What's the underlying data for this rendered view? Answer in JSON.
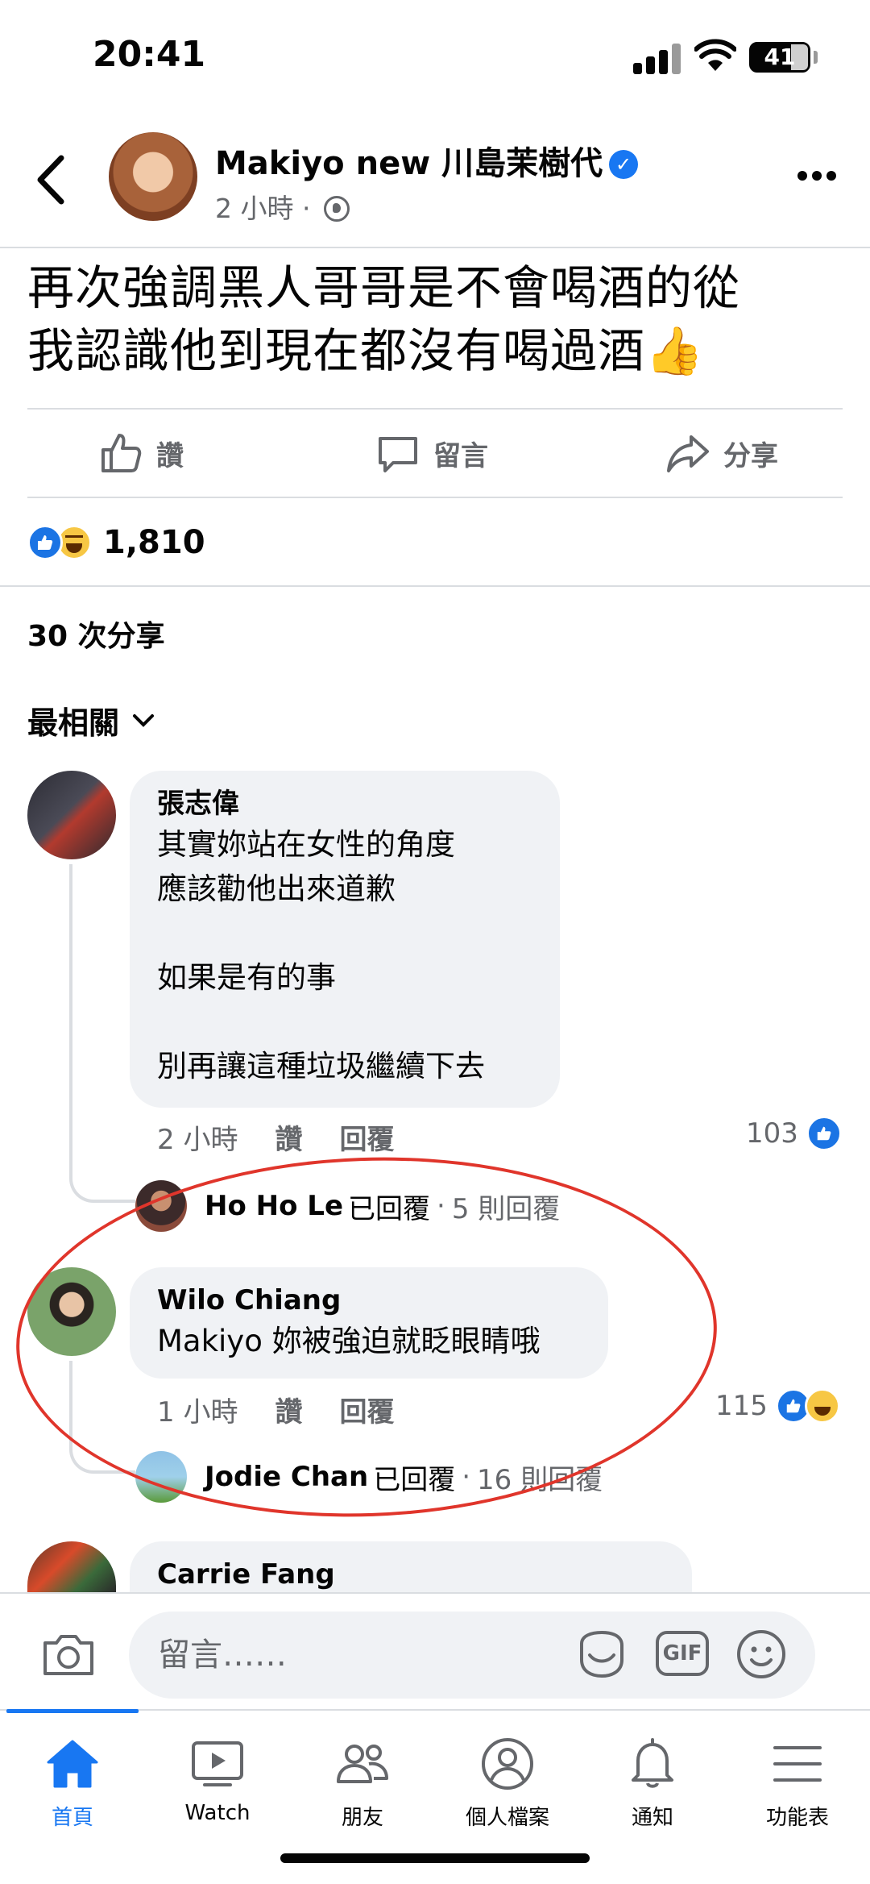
{
  "status_bar": {
    "time": "20:41",
    "battery": "41"
  },
  "post": {
    "author": "Makiyo new 川島茉樹代",
    "time": "2 小時",
    "separator": "·",
    "text_line1": "再次強調黑人哥哥是不會喝酒的從",
    "text_line2": "我認識他到現在都沒有喝過酒👍"
  },
  "actions": {
    "like": "讚",
    "comment": "留言",
    "share": "分享"
  },
  "reactions": {
    "count": "1,810"
  },
  "shares": "30 次分享",
  "sort_label": "最相關",
  "comments": [
    {
      "name": "張志偉",
      "text": "其實妳站在女性的角度\n應該勸他出來道歉\n\n如果是有的事\n\n別再讓這種垃圾繼續下去",
      "time": "2 小時",
      "like_label": "讚",
      "reply_label": "回覆",
      "count": "103",
      "reply_preview": {
        "name": "Ho Ho Le",
        "replied": "已回覆",
        "more": "5 則回覆"
      }
    },
    {
      "name": "Wilo Chiang",
      "text": "Makiyo 妳被強迫就眨眼睛哦",
      "time": "1 小時",
      "like_label": "讚",
      "reply_label": "回覆",
      "count": "115",
      "reply_preview": {
        "name": "Jodie Chan",
        "replied": "已回覆",
        "more": "16 則回覆"
      }
    },
    {
      "name": "Carrie Fang"
    }
  ],
  "composer": {
    "placeholder": "留言……",
    "gif": "GIF"
  },
  "nav": [
    {
      "label": "首頁"
    },
    {
      "label": "Watch"
    },
    {
      "label": "朋友"
    },
    {
      "label": "個人檔案"
    },
    {
      "label": "通知"
    },
    {
      "label": "功能表"
    }
  ],
  "colors": {
    "accent": "#1877f2",
    "annotation": "#e0352b",
    "bubble": "#f0f2f5",
    "muted": "#65676b"
  }
}
